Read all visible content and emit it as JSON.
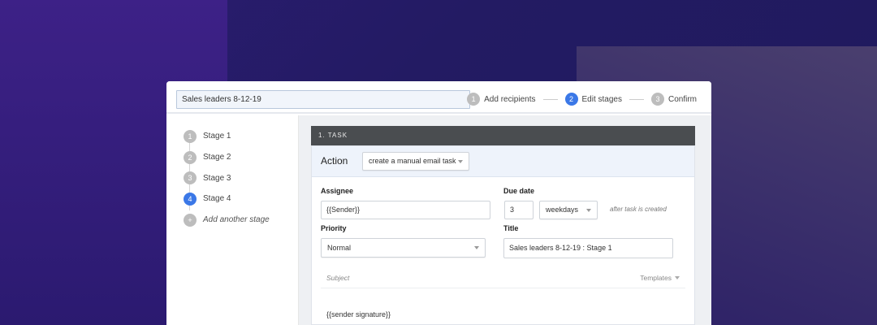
{
  "campaign": {
    "name": "Sales leaders 8-12-19"
  },
  "steps": [
    {
      "num": "1",
      "label": "Add recipients",
      "active": false
    },
    {
      "num": "2",
      "label": "Edit stages",
      "active": true
    },
    {
      "num": "3",
      "label": "Confirm",
      "active": false
    }
  ],
  "sidebar": {
    "stages": [
      {
        "num": "1",
        "label": "Stage 1"
      },
      {
        "num": "2",
        "label": "Stage 2"
      },
      {
        "num": "3",
        "label": "Stage 3"
      },
      {
        "num": "4",
        "label": "Stage 4"
      }
    ],
    "add_icon": "+",
    "add_label": "Add another stage"
  },
  "task": {
    "header": "1. TASK",
    "action_label": "Action",
    "action_value": "create a manual email task",
    "assignee_label": "Assignee",
    "assignee_value": "{{Sender}}",
    "due_label": "Due date",
    "due_number": "3",
    "due_unit": "weekdays",
    "due_hint": "after task is created",
    "priority_label": "Priority",
    "priority_value": "Normal",
    "title_label": "Title",
    "title_value": "Sales leaders 8-12-19 : Stage 1",
    "subject_placeholder": "Subject",
    "templates_label": "Templates",
    "body": "{{sender signature}}"
  },
  "colors": {
    "accent": "#3b78e7",
    "inactive": "#bdbdbd",
    "header_bg": "#4a4d50"
  }
}
